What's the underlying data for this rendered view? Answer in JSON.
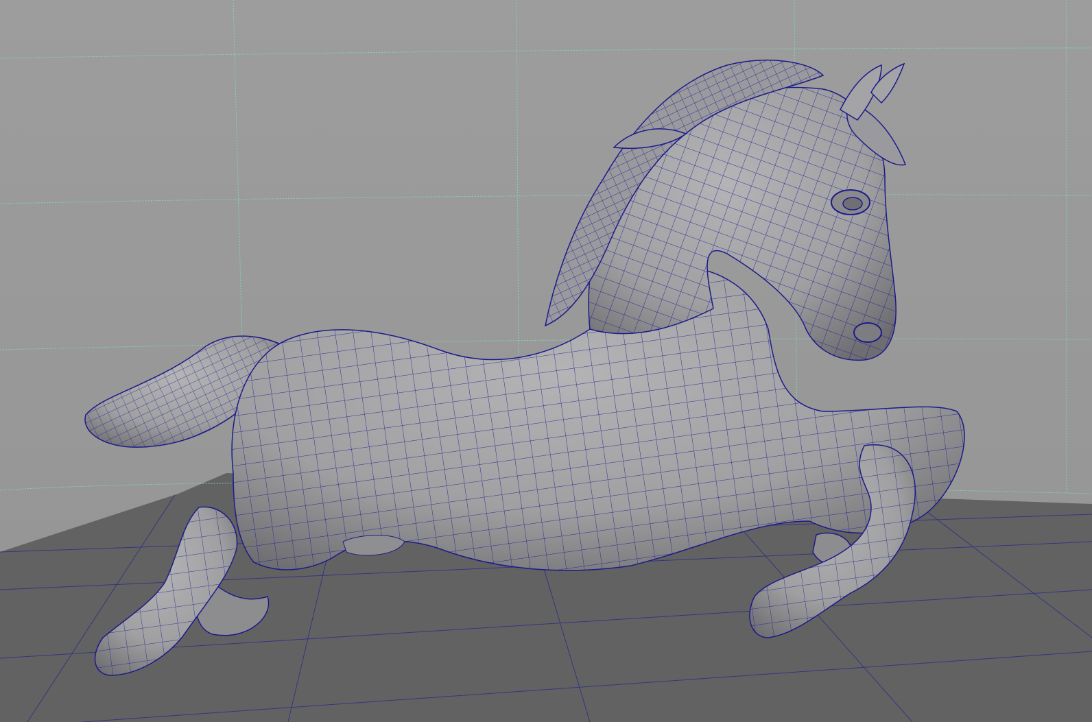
{
  "viewport": {
    "name": "3d-viewport",
    "background_color": "#989898",
    "floor_color": "#5f5f5f",
    "guide_line_color": "#7fd6b8",
    "wireframe_color": "#1c1a8a",
    "model_color": "#a4a4a6"
  },
  "scene": {
    "model": "horse-mesh",
    "display_mode": "smooth-shade-with-wireframe"
  }
}
